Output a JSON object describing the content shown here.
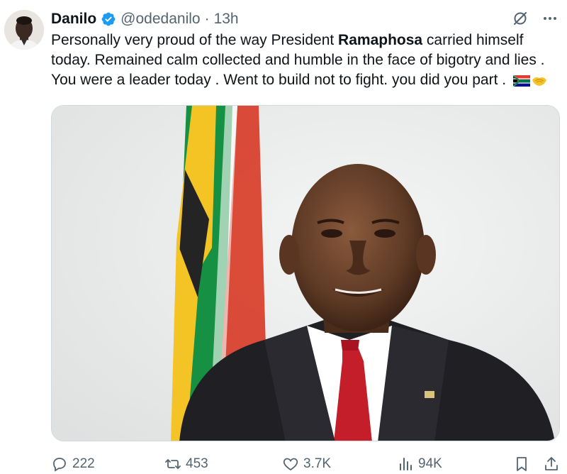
{
  "author": {
    "name": "Danilo",
    "handle": "@odedanilo",
    "separator": "·",
    "time": "13h",
    "verified": true
  },
  "tweet": {
    "text_before_bold": "Personally very proud of the way President ",
    "bold_word": "Ramaphosa",
    "text_after_bold": " carried himself today. Remained calm collected and humble in the face of bigotry and lies . You were a leader today . Went to build not to fight. you did you part . ",
    "emojis": [
      "south-africa-flag-emoji",
      "handshake-emoji"
    ]
  },
  "actions": {
    "replies": "222",
    "reposts": "453",
    "likes": "3.7K",
    "views": "94K"
  },
  "colors": {
    "text": "#0f1419",
    "muted": "#536471",
    "verified_blue": "#1d9bf0",
    "border": "#cfd9de"
  },
  "icons": {
    "top_right": [
      "grok-icon",
      "more-icon"
    ],
    "action_bar": [
      "reply-icon",
      "repost-icon",
      "like-icon",
      "views-icon",
      "bookmark-icon",
      "share-icon"
    ]
  }
}
